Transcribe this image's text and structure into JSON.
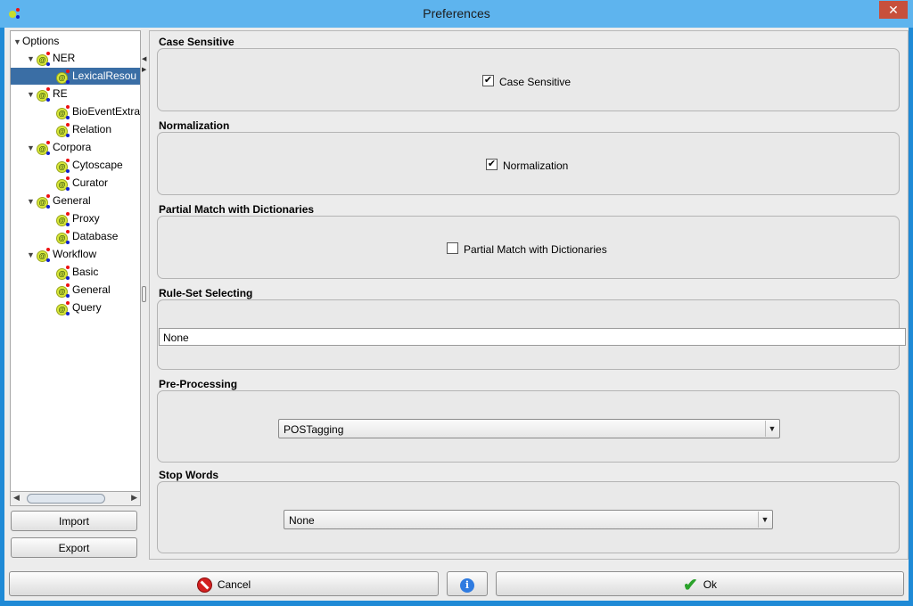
{
  "window": {
    "title": "Preferences",
    "close_glyph": "✕"
  },
  "tree": {
    "root": "Options",
    "groups": [
      {
        "label": "NER",
        "children": [
          "LexicalResou"
        ]
      },
      {
        "label": "RE",
        "children": [
          "BioEventExtra",
          "Relation"
        ]
      },
      {
        "label": "Corpora",
        "children": [
          "Cytoscape",
          "Curator"
        ]
      },
      {
        "label": "General",
        "children": [
          "Proxy",
          "Database"
        ]
      },
      {
        "label": "Workflow",
        "children": [
          "Basic",
          "General",
          "Query"
        ]
      }
    ],
    "selected": "LexicalResou"
  },
  "buttons": {
    "import": "Import",
    "export": "Export",
    "cancel": "Cancel",
    "ok": "Ok"
  },
  "sections": {
    "case_sensitive": {
      "title": "Case Sensitive",
      "checkbox_label": "Case Sensitive",
      "checked": true
    },
    "normalization": {
      "title": "Normalization",
      "checkbox_label": "Normalization",
      "checked": true
    },
    "partial_match": {
      "title": "Partial Match with Dictionaries",
      "checkbox_label": "Partial Match with Dictionaries",
      "checked": false
    },
    "rule_set": {
      "title": "Rule-Set Selecting",
      "value": "None"
    },
    "pre_processing": {
      "title": "Pre-Processing",
      "value": "POSTagging"
    },
    "stop_words": {
      "title": "Stop Words",
      "value": "None"
    }
  },
  "icons": {
    "node": "at-node-icon",
    "cancel": "cancel-icon",
    "info": "info-icon",
    "ok": "checkmark-icon"
  },
  "colors": {
    "titlebar": "#5eb4ee",
    "selection": "#3a6ea5",
    "close": "#c7503c"
  }
}
